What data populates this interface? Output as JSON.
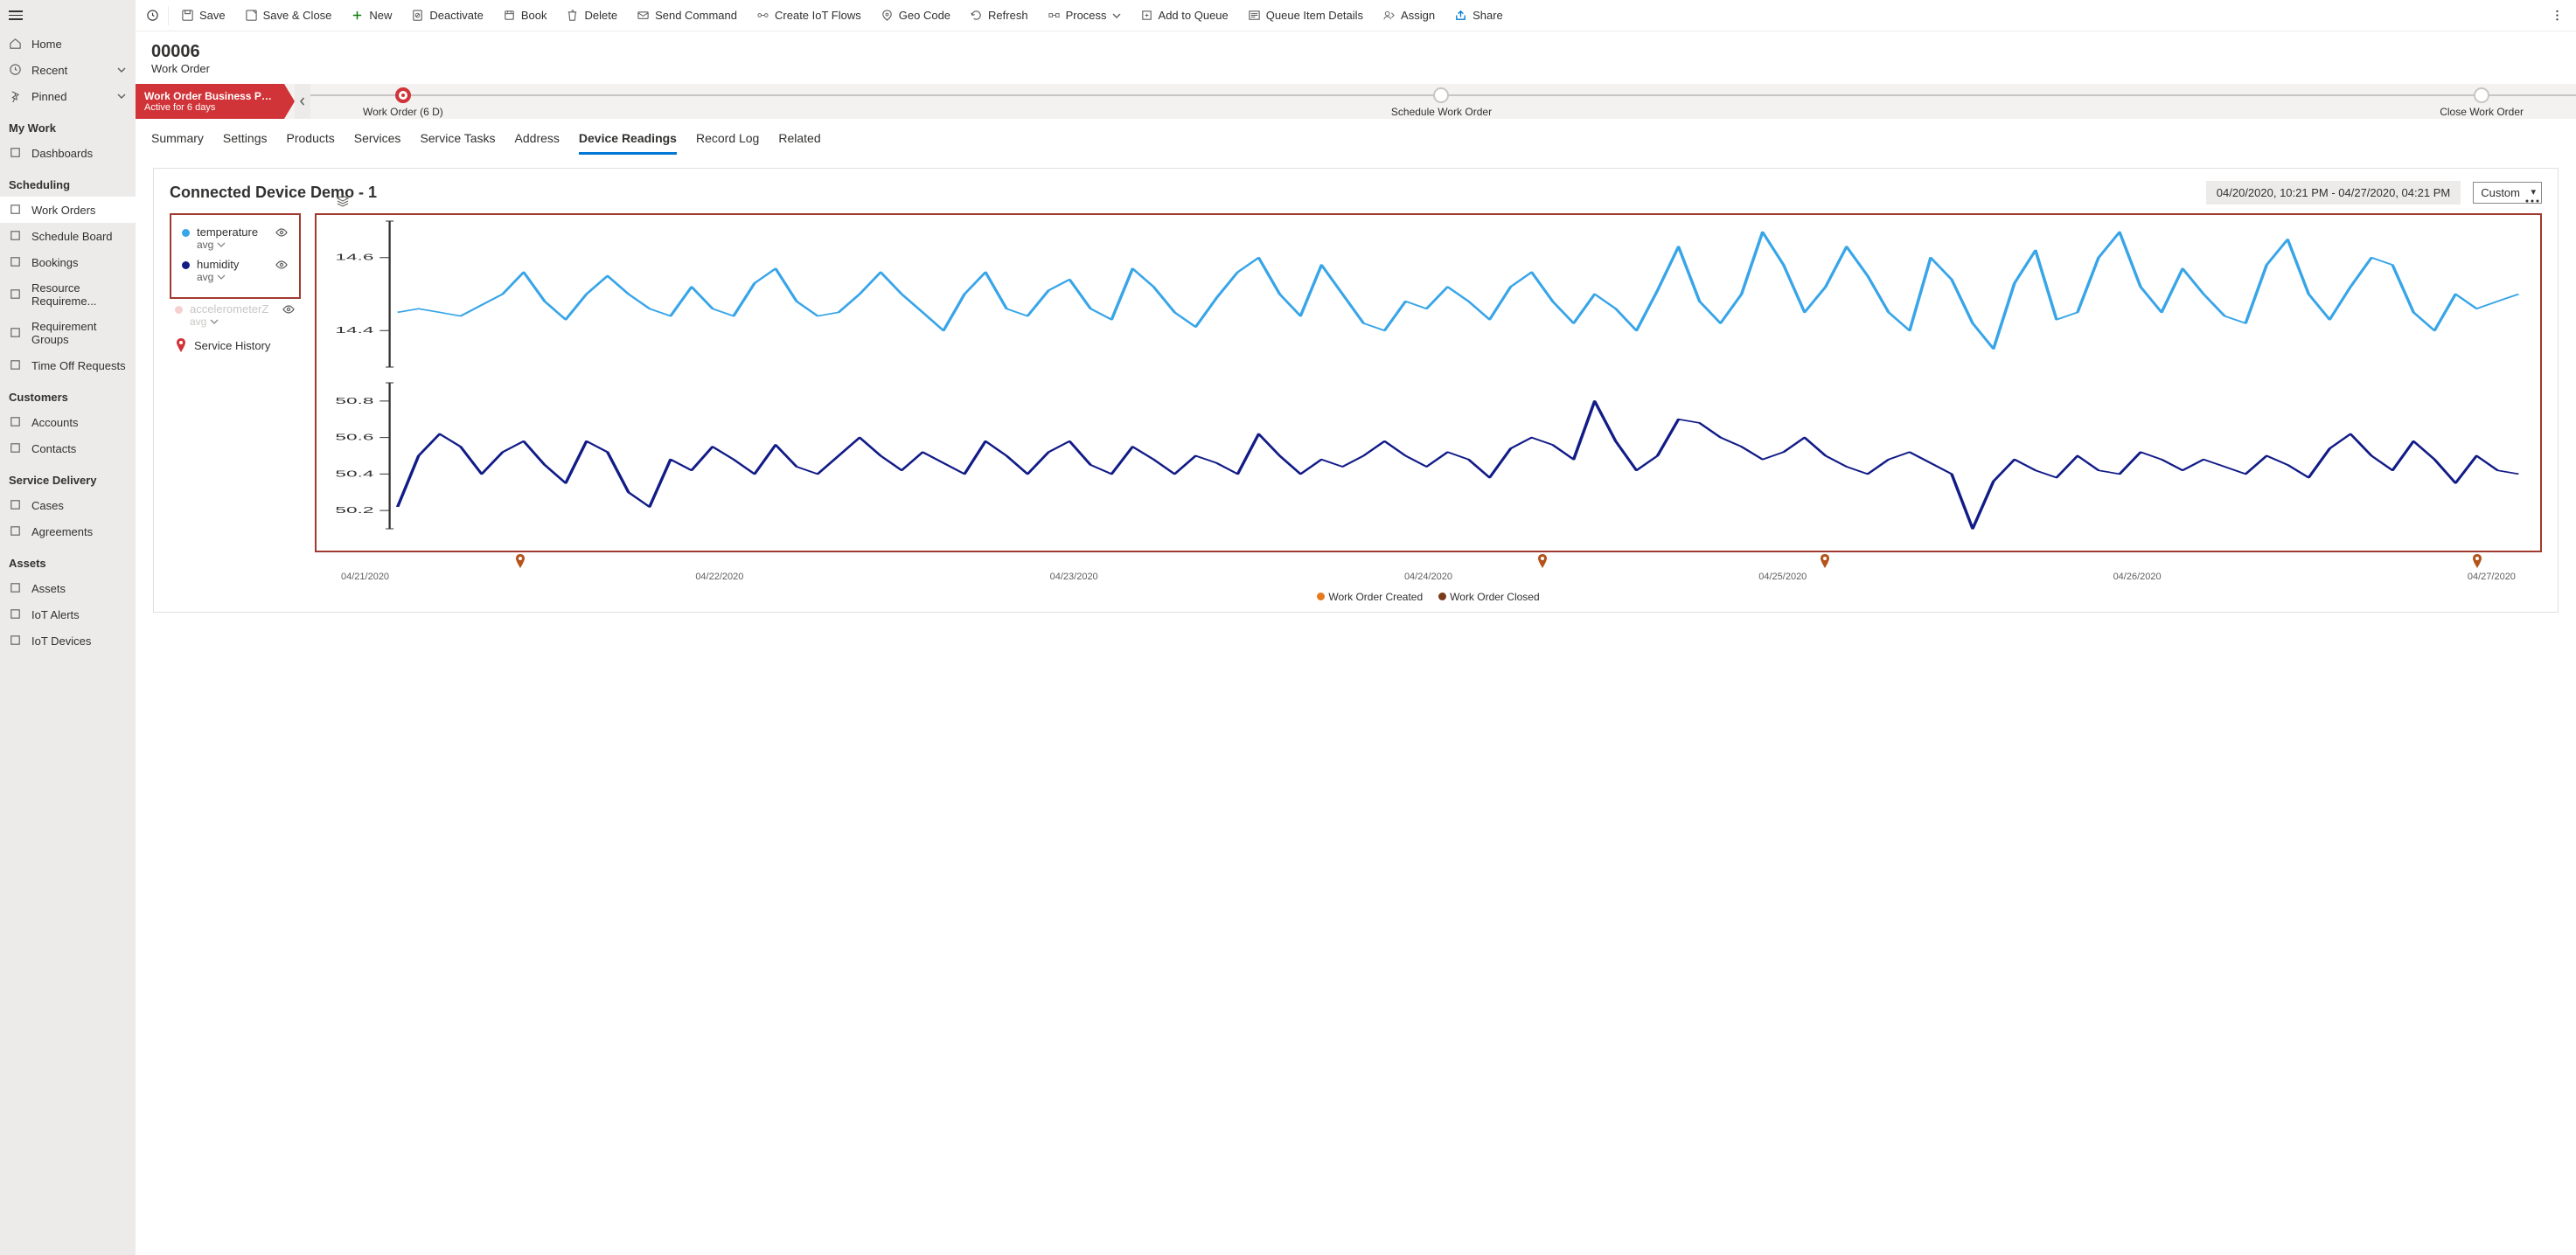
{
  "sidebar": {
    "top": [
      {
        "label": "Home",
        "icon": "home-icon"
      },
      {
        "label": "Recent",
        "icon": "clock-icon",
        "chevron": true
      },
      {
        "label": "Pinned",
        "icon": "pin-icon",
        "chevron": true
      }
    ],
    "groups": [
      {
        "header": "My Work",
        "items": [
          {
            "label": "Dashboards"
          }
        ]
      },
      {
        "header": "Scheduling",
        "items": [
          {
            "label": "Work Orders",
            "selected": true
          },
          {
            "label": "Schedule Board"
          },
          {
            "label": "Bookings"
          },
          {
            "label": "Resource Requireme..."
          },
          {
            "label": "Requirement Groups"
          },
          {
            "label": "Time Off Requests"
          }
        ]
      },
      {
        "header": "Customers",
        "items": [
          {
            "label": "Accounts"
          },
          {
            "label": "Contacts"
          }
        ]
      },
      {
        "header": "Service Delivery",
        "items": [
          {
            "label": "Cases"
          },
          {
            "label": "Agreements"
          }
        ]
      },
      {
        "header": "Assets",
        "items": [
          {
            "label": "Assets"
          },
          {
            "label": "IoT Alerts"
          },
          {
            "label": "IoT Devices"
          }
        ]
      }
    ]
  },
  "commandBar": {
    "items": [
      {
        "label": "Save",
        "icon": "save-icon"
      },
      {
        "label": "Save & Close",
        "icon": "save-close-icon"
      },
      {
        "label": "New",
        "icon": "plus-icon",
        "green": true
      },
      {
        "label": "Deactivate",
        "icon": "deactivate-icon"
      },
      {
        "label": "Book",
        "icon": "book-icon"
      },
      {
        "label": "Delete",
        "icon": "delete-icon"
      },
      {
        "label": "Send Command",
        "icon": "send-icon"
      },
      {
        "label": "Create IoT Flows",
        "icon": "flow-icon"
      },
      {
        "label": "Geo Code",
        "icon": "geo-icon"
      },
      {
        "label": "Refresh",
        "icon": "refresh-icon"
      },
      {
        "label": "Process",
        "icon": "process-icon",
        "chevron": true
      },
      {
        "label": "Add to Queue",
        "icon": "queue-add-icon"
      },
      {
        "label": "Queue Item Details",
        "icon": "queue-details-icon"
      },
      {
        "label": "Assign",
        "icon": "assign-icon"
      },
      {
        "label": "Share",
        "icon": "share-icon"
      }
    ]
  },
  "record": {
    "title": "00006",
    "subtitle": "Work Order"
  },
  "stage": {
    "flagTitle": "Work Order Business Pro...",
    "flagSub": "Active for 6 days",
    "nodes": [
      {
        "label": "Work Order  (6 D)",
        "active": true
      },
      {
        "label": "Schedule Work Order"
      },
      {
        "label": "Close Work Order"
      }
    ]
  },
  "tabs": [
    {
      "label": "Summary"
    },
    {
      "label": "Settings"
    },
    {
      "label": "Products"
    },
    {
      "label": "Services"
    },
    {
      "label": "Service Tasks"
    },
    {
      "label": "Address"
    },
    {
      "label": "Device Readings",
      "active": true
    },
    {
      "label": "Record Log"
    },
    {
      "label": "Related"
    }
  ],
  "readings": {
    "title": "Connected Device Demo - 1",
    "dateRange": "04/20/2020, 10:21 PM - 04/27/2020, 04:21 PM",
    "dropdown": "Custom",
    "legend": [
      {
        "name": "temperature",
        "agg": "avg",
        "color": "#38a5e8",
        "enabled": true
      },
      {
        "name": "humidity",
        "agg": "avg",
        "color": "#121c87",
        "enabled": true
      },
      {
        "name": "accelerometerZ",
        "agg": "avg",
        "color": "#f6cfcf",
        "enabled": false
      }
    ],
    "serviceHistory": "Service History",
    "bottomLegend": {
      "created": "Work Order Created",
      "closed": "Work Order Closed"
    }
  },
  "chart_data": {
    "type": "line",
    "xlabel": "",
    "x_categories": [
      "04/21/2020",
      "04/22/2020",
      "04/23/2020",
      "04/24/2020",
      "04/25/2020",
      "04/26/2020",
      "04/27/2020"
    ],
    "series": [
      {
        "name": "temperature",
        "color": "#38a5e8",
        "ylim": [
          14.3,
          14.7
        ],
        "yticks": [
          14.4,
          14.6
        ],
        "values": [
          14.45,
          14.46,
          14.45,
          14.44,
          14.47,
          14.5,
          14.56,
          14.48,
          14.43,
          14.5,
          14.55,
          14.5,
          14.46,
          14.44,
          14.52,
          14.46,
          14.44,
          14.53,
          14.57,
          14.48,
          14.44,
          14.45,
          14.5,
          14.56,
          14.5,
          14.45,
          14.4,
          14.5,
          14.56,
          14.46,
          14.44,
          14.51,
          14.54,
          14.46,
          14.43,
          14.57,
          14.52,
          14.45,
          14.41,
          14.49,
          14.56,
          14.6,
          14.5,
          14.44,
          14.58,
          14.5,
          14.42,
          14.4,
          14.48,
          14.46,
          14.52,
          14.48,
          14.43,
          14.52,
          14.56,
          14.48,
          14.42,
          14.5,
          14.46,
          14.4,
          14.51,
          14.63,
          14.48,
          14.42,
          14.5,
          14.67,
          14.58,
          14.45,
          14.52,
          14.63,
          14.55,
          14.45,
          14.4,
          14.6,
          14.54,
          14.42,
          14.35,
          14.53,
          14.62,
          14.43,
          14.45,
          14.6,
          14.67,
          14.52,
          14.45,
          14.57,
          14.5,
          14.44,
          14.42,
          14.58,
          14.65,
          14.5,
          14.43,
          14.52,
          14.6,
          14.58,
          14.45,
          14.4,
          14.5,
          14.46,
          14.48,
          14.5
        ]
      },
      {
        "name": "humidity",
        "color": "#121c87",
        "ylim": [
          50.1,
          50.9
        ],
        "yticks": [
          50.2,
          50.4,
          50.6,
          50.8
        ],
        "values": [
          50.22,
          50.5,
          50.62,
          50.55,
          50.4,
          50.52,
          50.58,
          50.45,
          50.35,
          50.58,
          50.52,
          50.3,
          50.22,
          50.48,
          50.42,
          50.55,
          50.48,
          50.4,
          50.56,
          50.44,
          50.4,
          50.5,
          50.6,
          50.5,
          50.42,
          50.52,
          50.46,
          50.4,
          50.58,
          50.5,
          50.4,
          50.52,
          50.58,
          50.45,
          50.4,
          50.55,
          50.48,
          50.4,
          50.5,
          50.46,
          50.4,
          50.62,
          50.5,
          50.4,
          50.48,
          50.44,
          50.5,
          50.58,
          50.5,
          50.44,
          50.52,
          50.48,
          50.38,
          50.54,
          50.6,
          50.56,
          50.48,
          50.8,
          50.58,
          50.42,
          50.5,
          50.7,
          50.68,
          50.6,
          50.55,
          50.48,
          50.52,
          50.6,
          50.5,
          50.44,
          50.4,
          50.48,
          50.52,
          50.46,
          50.4,
          50.1,
          50.36,
          50.48,
          50.42,
          50.38,
          50.5,
          50.42,
          50.4,
          50.52,
          50.48,
          50.42,
          50.48,
          50.44,
          50.4,
          50.5,
          50.45,
          50.38,
          50.54,
          50.62,
          50.5,
          50.42,
          50.58,
          50.48,
          50.35,
          50.5,
          50.42,
          50.4
        ]
      }
    ],
    "service_history_pins_pct": [
      8,
      55,
      68,
      98
    ]
  }
}
